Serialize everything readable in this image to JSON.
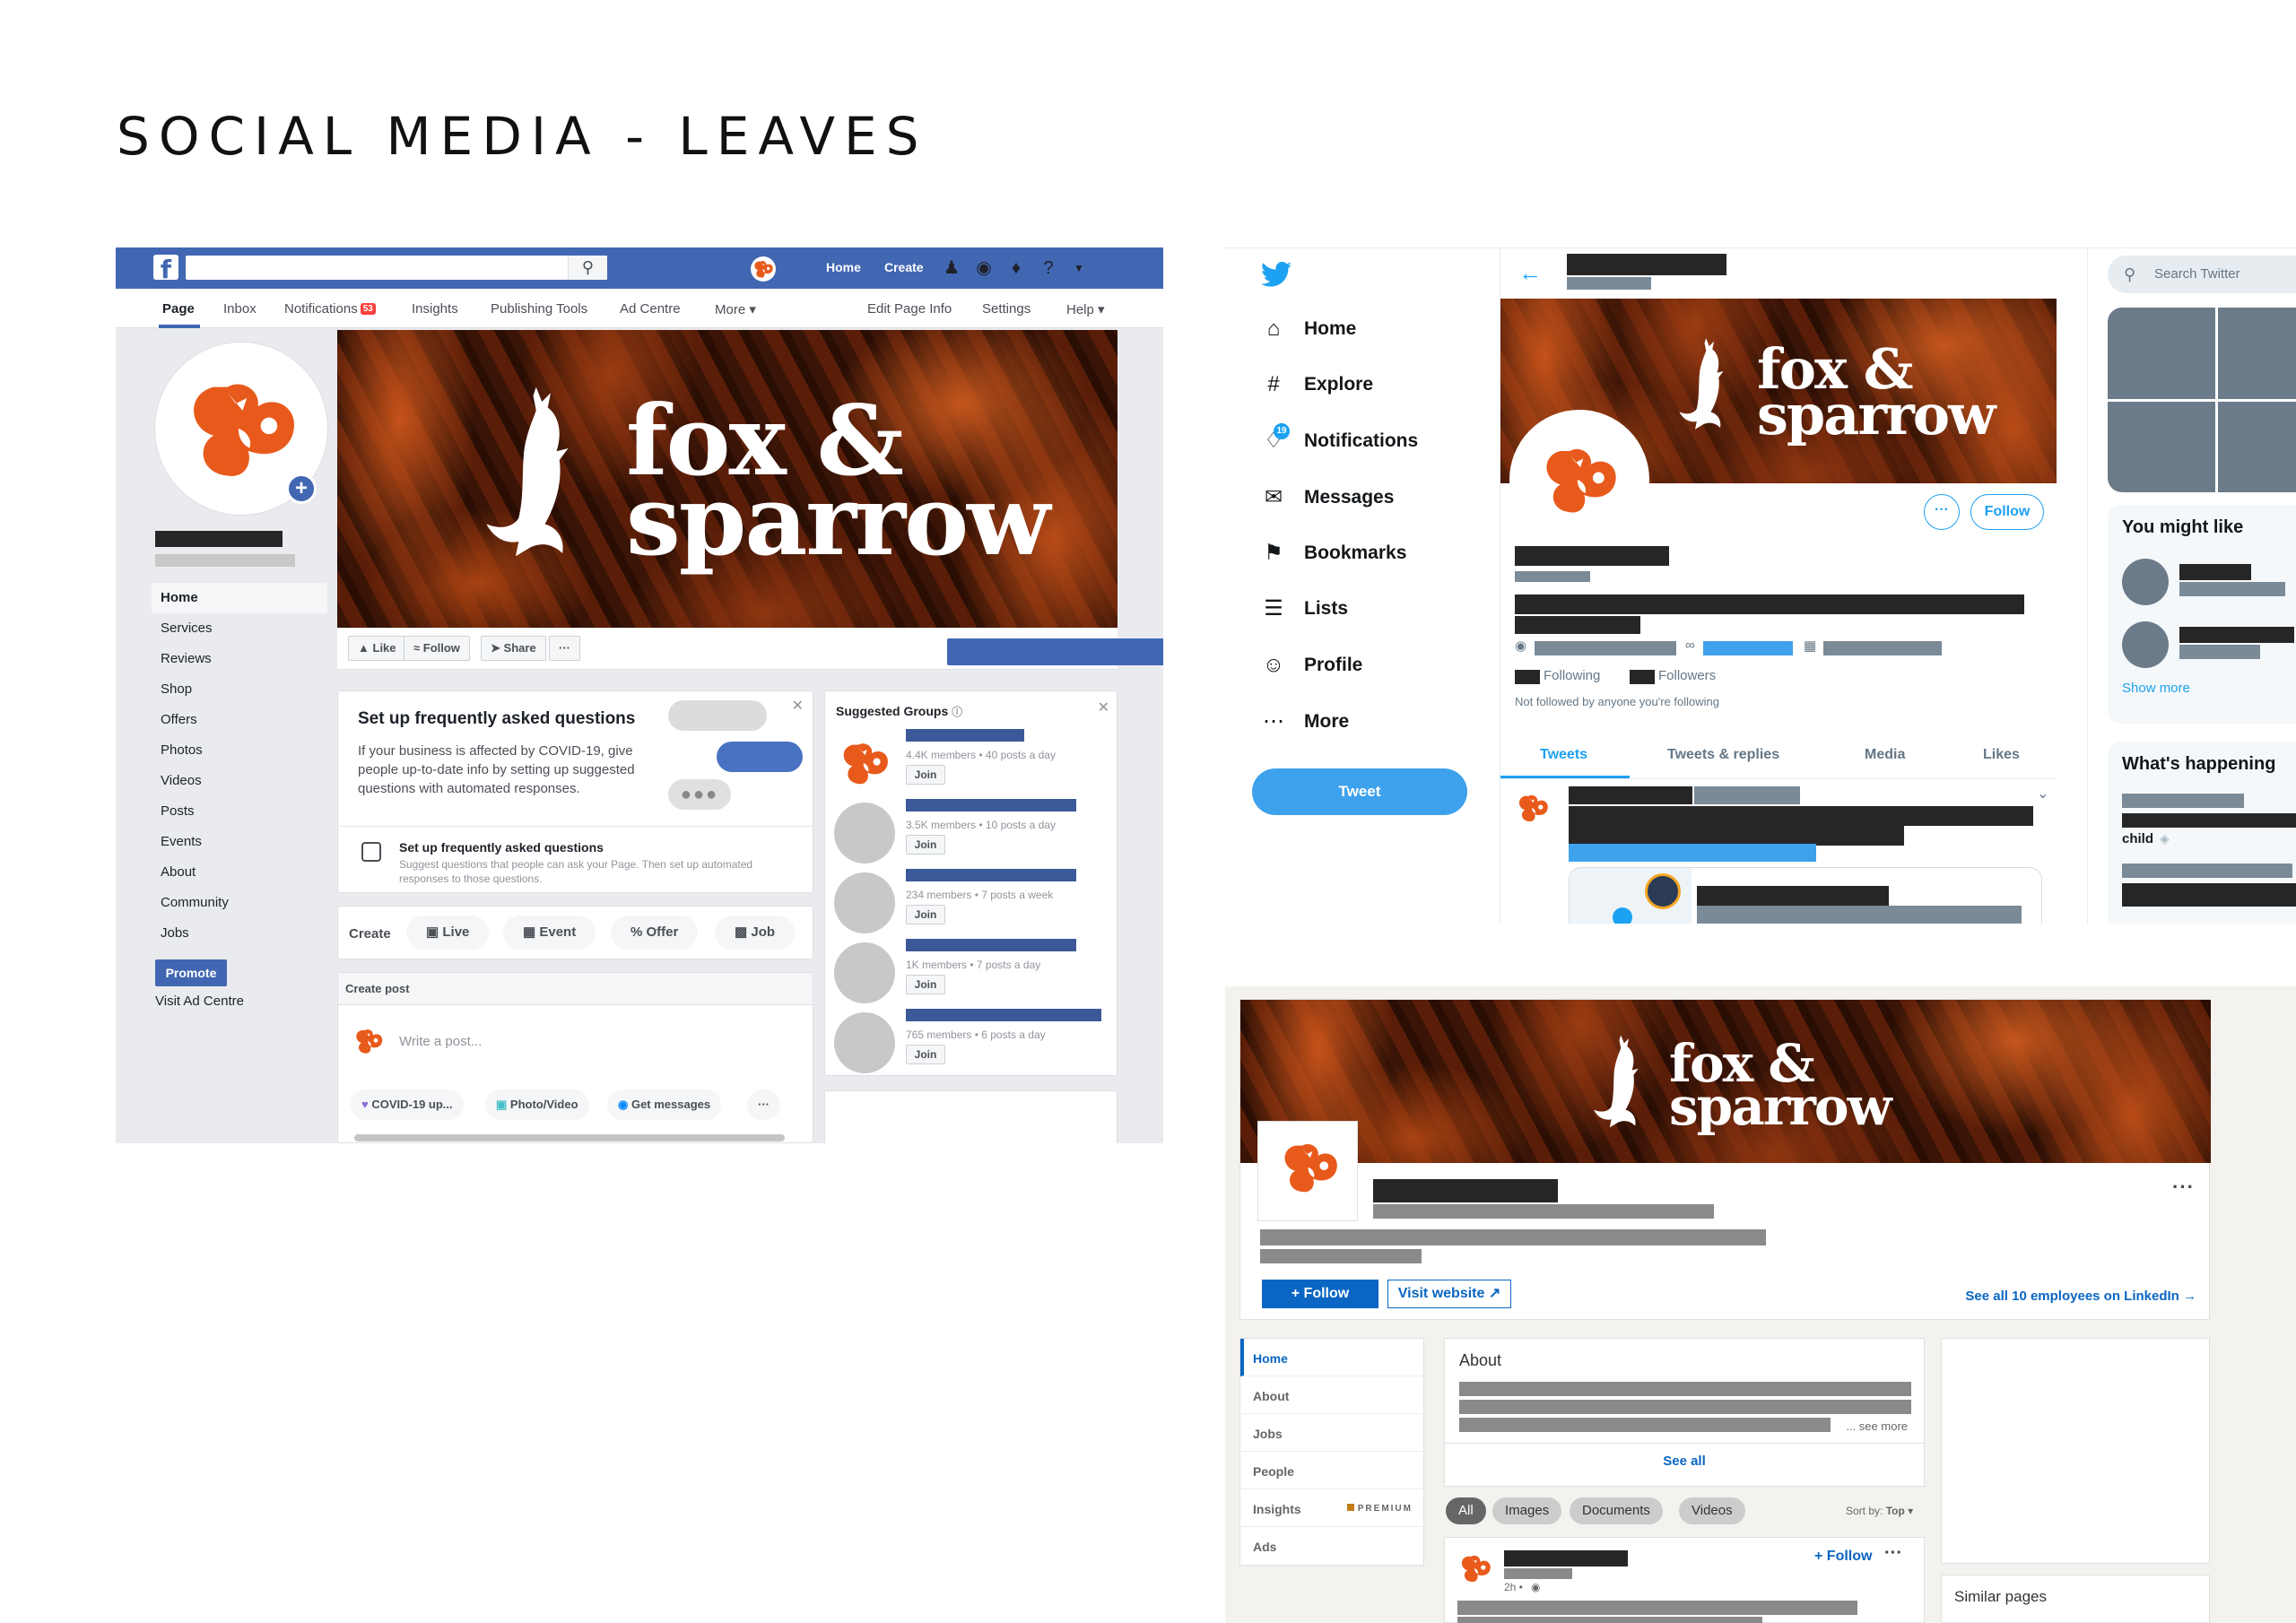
{
  "page_title": "SOCIAL MEDIA - LEAVES",
  "brand": {
    "line1": "fox &",
    "line2": "sparrow",
    "color": "#e85a1b"
  },
  "facebook": {
    "logo": "f",
    "top_links": [
      "Home",
      "Create"
    ],
    "tabs": [
      "Page",
      "Inbox",
      "Notifications",
      "Insights",
      "Publishing Tools",
      "Ad Centre",
      "More ▾",
      "Edit Page Info",
      "Settings",
      "Help ▾"
    ],
    "notifications_badge": "53",
    "sidebar": [
      "Home",
      "Services",
      "Reviews",
      "Shop",
      "Offers",
      "Photos",
      "Videos",
      "Posts",
      "Events",
      "About",
      "Community",
      "Jobs"
    ],
    "promote": "Promote",
    "visit_ad_centre": "Visit Ad Centre",
    "actions": {
      "like": "Like",
      "follow": "Follow",
      "share": "Share",
      "more": "···"
    },
    "faq": {
      "title": "Set up frequently asked questions",
      "body": "If your business is affected by COVID-19, give people up-to-date info by setting up suggested questions with automated responses.",
      "sub_title": "Set up frequently asked questions",
      "sub_text": "Suggest questions that people can ask your Page. Then set up automated responses to those questions.",
      "dots": "●●●"
    },
    "create": {
      "label": "Create",
      "items": [
        "Live",
        "Event",
        "Offer",
        "Job"
      ]
    },
    "post": {
      "header": "Create post",
      "placeholder": "Write a post...",
      "chips": [
        "COVID-19 up...",
        "Photo/Video",
        "Get messages",
        "···"
      ]
    },
    "groups": {
      "title": "Suggested Groups",
      "items": [
        {
          "meta": "4.4K members • 40 posts a day",
          "join": "Join"
        },
        {
          "meta": "3.5K members • 10 posts a day",
          "join": "Join"
        },
        {
          "meta": "234 members • 7 posts a week",
          "join": "Join"
        },
        {
          "meta": "1K members • 7 posts a day",
          "join": "Join"
        },
        {
          "meta": "765 members • 6 posts a day",
          "join": "Join"
        }
      ]
    }
  },
  "twitter": {
    "nav": [
      "Home",
      "Explore",
      "Notifications",
      "Messages",
      "Bookmarks",
      "Lists",
      "Profile",
      "More"
    ],
    "notif_count": "19",
    "tweet_button": "Tweet",
    "follow": "Follow",
    "following": "Following",
    "followers": "Followers",
    "not_followed": "Not followed by anyone you're following",
    "tabs": [
      "Tweets",
      "Tweets & replies",
      "Media",
      "Likes"
    ],
    "search_placeholder": "Search Twitter",
    "you_might_like": "You might like",
    "show_more": "Show more",
    "whats_happening": "What's happening",
    "trend_word": "child"
  },
  "linkedin": {
    "follow": "+ Follow",
    "visit_website": "Visit website",
    "see_all_employees": "See all 10 employees on LinkedIn →",
    "nav": [
      "Home",
      "About",
      "Jobs",
      "People",
      "Insights",
      "Ads"
    ],
    "premium": "PREMIUM",
    "about_title": "About",
    "see_more": "... see more",
    "see_all": "See all",
    "filters": [
      "All",
      "Images",
      "Documents",
      "Videos"
    ],
    "sort_label": "Sort by:",
    "sort_value": "Top",
    "post_follow": "+ Follow",
    "post_time": "2h •",
    "similar_pages": "Similar pages"
  }
}
